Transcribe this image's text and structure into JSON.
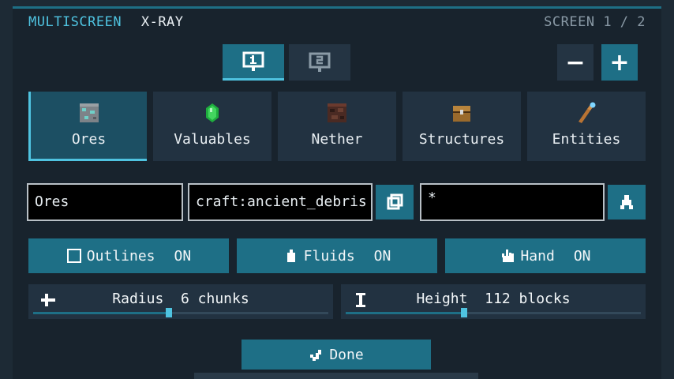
{
  "header": {
    "brand": "MULTISCREEN",
    "mode": "X-RAY",
    "screen_indicator": "SCREEN 1 / 2"
  },
  "screen_tabs": [
    {
      "label": "1",
      "icon": "monitor-1-icon",
      "active": true
    },
    {
      "label": "2",
      "icon": "monitor-2-icon",
      "active": false
    }
  ],
  "screen_controls": {
    "remove_label": "−",
    "add_label": "+"
  },
  "categories": [
    {
      "label": "Ores",
      "icon": "ore-block-icon",
      "active": true
    },
    {
      "label": "Valuables",
      "icon": "emerald-icon",
      "active": false
    },
    {
      "label": "Nether",
      "icon": "netherrack-icon",
      "active": false
    },
    {
      "label": "Structures",
      "icon": "chest-icon",
      "active": false
    },
    {
      "label": "Entities",
      "icon": "spyglass-icon",
      "active": false
    }
  ],
  "filters": {
    "name_value": "Ores",
    "block_id_value": "craft:ancient_debris",
    "pattern_value": "*"
  },
  "toggles": [
    {
      "label": "Outlines",
      "value": "ON",
      "icon": "outline-box-icon"
    },
    {
      "label": "Fluids",
      "value": "ON",
      "icon": "bucket-icon"
    },
    {
      "label": "Hand",
      "value": "ON",
      "icon": "hand-icon"
    }
  ],
  "sliders": [
    {
      "label": "Radius",
      "value": "6 chunks",
      "icon": "crosshair-icon",
      "fraction": 0.46
    },
    {
      "label": "Height",
      "value": "112 blocks",
      "icon": "height-bar-icon",
      "fraction": 0.4
    }
  ],
  "done_label": "Done",
  "colors": {
    "accent": "#1e6f86",
    "highlight": "#4fc3e0",
    "panel": "#18232d"
  }
}
